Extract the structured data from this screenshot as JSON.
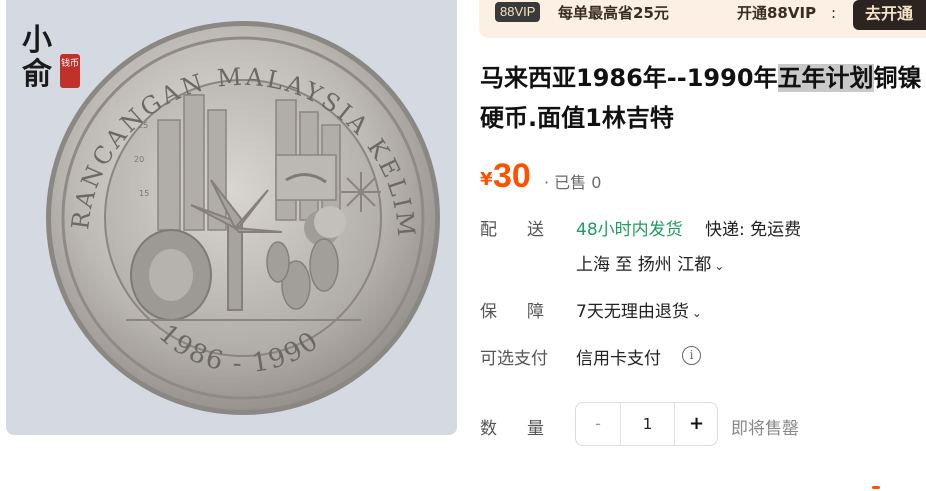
{
  "photo": {
    "coin_rim_text": "RANCANGAN MALAYSIA KELIMA",
    "coin_years": "1986 - 1990",
    "chart_ticks": [
      "25",
      "20",
      "15"
    ],
    "watermark_brush": [
      "小",
      "俞"
    ],
    "watermark_stamp": "钱币"
  },
  "vip": {
    "badge": "88VIP",
    "save_text": "每单最高省25元",
    "open_text": "开通88VIP",
    "separator": ":",
    "cta": "去开通"
  },
  "product": {
    "title_before": "马来西亚1986年--1990年",
    "title_highlight": "五年计划",
    "title_after": "铜镍硬币.面值1林吉特"
  },
  "price": {
    "currency": "¥",
    "amount": "30",
    "sold": "· 已售 0"
  },
  "shipping": {
    "label_a": "配",
    "label_b": "送",
    "fast": "48小时内发货",
    "fee": "快递: 免运费",
    "route": "上海  至  扬州 江都"
  },
  "guarantee": {
    "label_a": "保",
    "label_b": "障",
    "value": "7天无理由退货"
  },
  "payment": {
    "label": "可选支付",
    "value": "信用卡支付",
    "info": "i"
  },
  "quantity": {
    "label_a": "数",
    "label_b": "量",
    "minus": "-",
    "value": "1",
    "plus": "+",
    "status": "即将售罄"
  },
  "icons": {
    "chevron": "chevron-down-icon",
    "info": "info-icon"
  },
  "colors": {
    "accent": "#ff5000",
    "ship_green": "#1e9b5e",
    "vip_bg": "#fcefe3",
    "vip_btn": "#2b2420",
    "coin_bg": "#d4d9e2"
  }
}
